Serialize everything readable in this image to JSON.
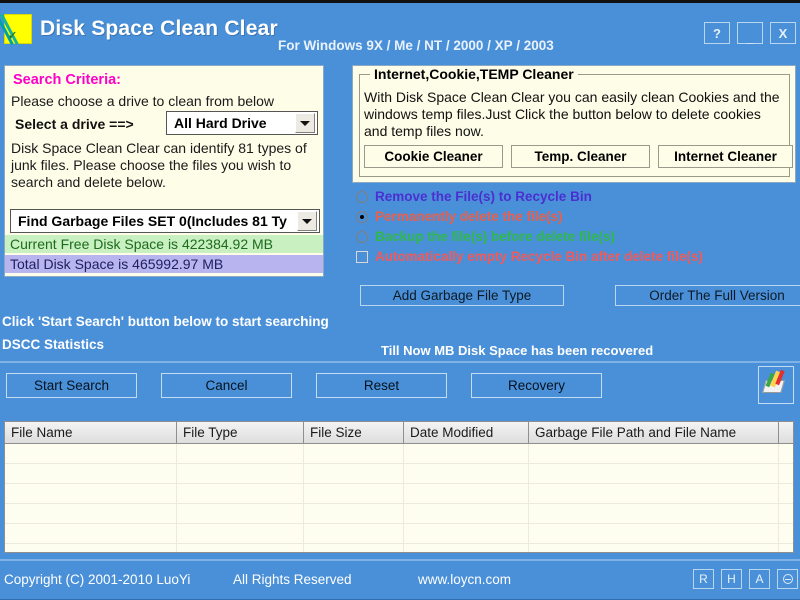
{
  "titlebar": {
    "icon": "app-logo-icon",
    "title": "Disk Space Clean Clear",
    "subtitle": "For Windows 9X / Me / NT / 2000 / XP / 2003",
    "controls": [
      {
        "name": "help-button",
        "label": "?"
      },
      {
        "name": "minimize-button",
        "label": "_"
      },
      {
        "name": "close-button",
        "label": "X"
      }
    ]
  },
  "search_criteria": {
    "heading": "Search Criteria:",
    "instruction": "Please choose a drive to clean from below",
    "drive_label": "Select a drive ==>",
    "drive_value": "All Hard Drive",
    "description": "Disk Space Clean Clear can identify 81 types of junk files. Please choose the files you wish to search and delete below.",
    "set_value": "Find Garbage Files SET 0(Includes 81 Ty",
    "free_space": "Current Free Disk Space is 422384.92 MB",
    "total_space": "Total Disk Space is 465992.97 MB"
  },
  "cleaner_group": {
    "title": "Internet,Cookie,TEMP Cleaner",
    "body": "With Disk Space Clean Clear you can easily clean Cookies and the windows temp files.Just Click the button below to delete cookies and temp files now.",
    "buttons": [
      {
        "name": "cookie-cleaner-button",
        "label": "Cookie Cleaner"
      },
      {
        "name": "temp-cleaner-button",
        "label": "Temp. Cleaner"
      },
      {
        "name": "internet-cleaner-button",
        "label": "Internet Cleaner"
      }
    ]
  },
  "delete_options": [
    {
      "type": "radio",
      "checked": false,
      "label": "Remove the File(s) to Recycle Bin",
      "color": "#4b2fd0"
    },
    {
      "type": "radio",
      "checked": true,
      "label": "Permanently delete the file(s)",
      "color": "#e8604c"
    },
    {
      "type": "radio",
      "checked": false,
      "label": "Backup the file(s) before delete file(s)",
      "color": "#2fb84a"
    },
    {
      "type": "checkbox",
      "checked": false,
      "label": "Automatically empty Recycle Bin after delete file(s)",
      "color": "#f05a5a"
    }
  ],
  "mid_buttons": [
    {
      "name": "add-garbage-file-type-button",
      "label": "Add Garbage File Type"
    },
    {
      "name": "order-full-version-button",
      "label": "Order The Full Version"
    }
  ],
  "status": {
    "line1": "Click 'Start Search' button below to start searching",
    "line2": "DSCC Statistics",
    "line3": "Till Now MB Disk Space has been recovered"
  },
  "actions": [
    {
      "name": "start-search-button",
      "label": "Start Search"
    },
    {
      "name": "cancel-button",
      "label": "Cancel"
    },
    {
      "name": "reset-button",
      "label": "Reset"
    },
    {
      "name": "recovery-button",
      "label": "Recovery"
    }
  ],
  "recovery_tool_icon": "broom-cleanup-icon",
  "table": {
    "columns": [
      "File Name",
      "File Type",
      "File Size",
      "Date Modified",
      "Garbage File Path and File Name",
      ""
    ],
    "rows": []
  },
  "footer": {
    "copyright": "Copyright (C) 2001-2010 LuoYi",
    "rights": "All Rights Reserved",
    "website": "www.loycn.com",
    "buttons": [
      {
        "name": "register-button",
        "label": "R"
      },
      {
        "name": "help-footer-button",
        "label": "H"
      },
      {
        "name": "about-button",
        "label": "A"
      },
      {
        "name": "minimize-tray-button",
        "label": ""
      }
    ]
  },
  "colors": {
    "window_blue": "#4a90d9",
    "panel_cream": "#fdfde8",
    "accent_magenta": "#ff00c8",
    "free_space_bg": "#c8f0c0",
    "total_space_bg": "#b8b4f0"
  }
}
